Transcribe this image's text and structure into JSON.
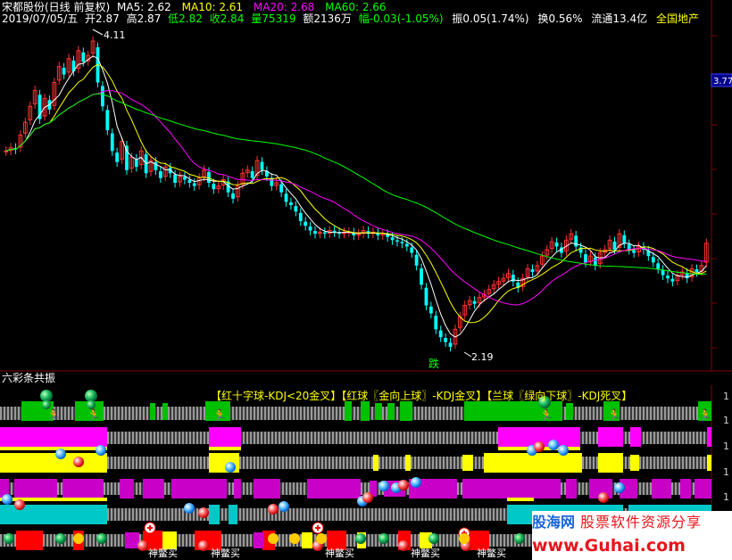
{
  "header": {
    "stock_name": "宋都股份(日线 前复权)",
    "ma5": "MA5: 2.62",
    "ma10": "MA10: 2.61",
    "ma20": "MA20: 2.68",
    "ma60": "MA60: 2.66",
    "date": "2019/07/05/五",
    "open": "开2.87",
    "high": "高2.87",
    "low": "低2.82",
    "close": "收2.84",
    "volume": "量75319",
    "amount": "额2136万",
    "change": "幅-0.03(-1.05%)",
    "amplitude": "振0.05(1.74%)",
    "turnover": "换0.56%",
    "float_cap": "流通13.4亿",
    "sector": "全国地产"
  },
  "annotations": {
    "high_label": "4.11",
    "low_label": "2.19",
    "fall_label": "跌",
    "price_tag": "3.77"
  },
  "indicator": {
    "title": "六彩条共振",
    "legend": "【红十字球-KDJ<20金叉】【红球〖金向上球〗-KDJ金叉】【兰球〖绿向下球〗-KDJ死叉】",
    "axis_digits": [
      "1",
      "1",
      "1",
      "1",
      "1",
      "1",
      "1"
    ],
    "buy_label": "神鳖买"
  },
  "watermark": {
    "brand": "股海网",
    "slogan": "股票软件资源分享",
    "url": "www.Guhai.com"
  },
  "colors": {
    "ma5": "#ffffff",
    "ma10": "#ffff00",
    "ma20": "#ff00ff",
    "ma60": "#00ff00",
    "up": "#ff3232",
    "down": "#00ffff",
    "row1": "#00c000",
    "row2": "#ff00ff",
    "row3": "#ffff00",
    "row4": "#c000c0",
    "row5": "#00c8c8",
    "row6": "#ff0000"
  },
  "chart_data": {
    "type": "candlestick",
    "title": "宋都股份(日线 前复权)",
    "period": "daily",
    "ylim": [
      2.1,
      4.2
    ],
    "marked_high": 4.11,
    "marked_low": 2.19,
    "last_close": 2.84,
    "price_tag": 3.77,
    "series": [
      {
        "name": "MA5",
        "last": 2.62
      },
      {
        "name": "MA10",
        "last": 2.61
      },
      {
        "name": "MA20",
        "last": 2.68
      },
      {
        "name": "MA60",
        "last": 2.66
      }
    ],
    "closes": [
      3.42,
      3.44,
      3.43,
      3.52,
      3.6,
      3.7,
      3.8,
      3.62,
      3.75,
      3.68,
      3.85,
      3.95,
      3.9,
      4.0,
      3.92,
      4.05,
      3.98,
      4.02,
      4.11,
      3.85,
      3.7,
      3.55,
      3.42,
      3.35,
      3.48,
      3.3,
      3.38,
      3.32,
      3.42,
      3.28,
      3.36,
      3.3,
      3.25,
      3.32,
      3.28,
      3.22,
      3.26,
      3.24,
      3.22,
      3.2,
      3.25,
      3.3,
      3.22,
      3.18,
      3.2,
      3.24,
      3.16,
      3.12,
      3.2,
      3.28,
      3.3,
      3.25,
      3.36,
      3.3,
      3.26,
      3.2,
      3.22,
      3.16,
      3.1,
      3.08,
      3.04,
      2.98,
      2.95,
      2.92,
      2.9,
      2.91,
      2.9,
      2.92,
      2.91,
      2.9,
      2.91,
      2.91,
      2.89,
      2.9,
      2.92,
      2.9,
      2.91,
      2.89,
      2.9,
      2.88,
      2.86,
      2.85,
      2.84,
      2.82,
      2.78,
      2.7,
      2.58,
      2.45,
      2.4,
      2.3,
      2.25,
      2.22,
      2.19,
      2.3,
      2.38,
      2.45,
      2.48,
      2.46,
      2.5,
      2.52,
      2.55,
      2.58,
      2.6,
      2.62,
      2.65,
      2.6,
      2.56,
      2.62,
      2.68,
      2.66,
      2.7,
      2.76,
      2.8,
      2.85,
      2.82,
      2.78,
      2.86,
      2.9,
      2.82,
      2.78,
      2.72,
      2.76,
      2.7,
      2.78,
      2.8,
      2.86,
      2.8,
      2.9,
      2.84,
      2.8,
      2.78,
      2.82,
      2.8,
      2.76,
      2.72,
      2.68,
      2.64,
      2.62,
      2.6,
      2.64,
      2.66,
      2.62,
      2.68,
      2.66,
      2.7,
      2.84
    ]
  }
}
